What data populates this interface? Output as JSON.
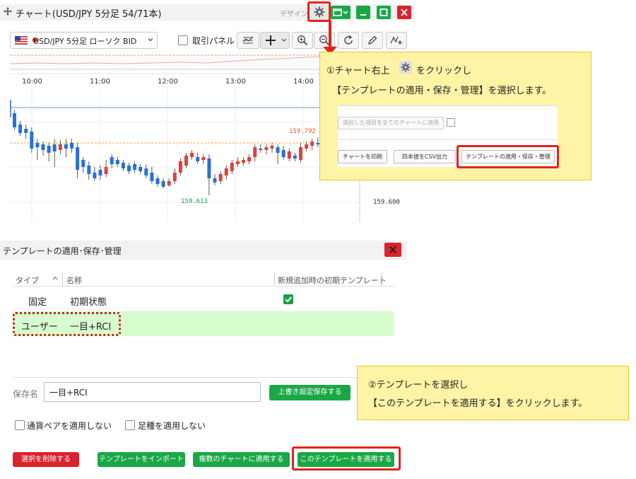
{
  "chart_window": {
    "title": "チャート(USD/JPY 5分足 54/71本)",
    "design_label": "デザイン",
    "pair_select": "USD/JPY 5分足 ローソク BID",
    "trade_panel_label": "取引パネル",
    "time_labels": [
      "10:00",
      "11:00",
      "12:00",
      "13:00",
      "14:00"
    ],
    "high_label": "159.792",
    "low_label": "159.613",
    "price_label": "159.600"
  },
  "callout1": {
    "line1_prefix": "①チャート右上",
    "line1_suffix": "をクリックし",
    "line2": "【テンプレートの適用・保存・管理】を選択します。",
    "mini": {
      "apply_all": "選択した項目を全てのチャートに適用",
      "print": "チャートを印刷",
      "csv": "四本値をCSV出力",
      "template": "テンプレートの適用・保存・管理"
    }
  },
  "dialog": {
    "title": "テンプレートの適用･保存･管理",
    "columns": {
      "type": "タイプ",
      "name": "名称",
      "default": "新規追加時の初期テンプレート"
    },
    "rows": [
      {
        "type": "固定",
        "name": "初期状態"
      },
      {
        "type": "ユーザー",
        "name": "一目+RCI"
      }
    ],
    "save_name_label": "保存名",
    "save_name_value": "一目+RCI",
    "overwrite_button": "上書き設定保存する",
    "no_pair_label": "通貨ペアを適用しない",
    "no_timeframe_label": "足種を適用しない",
    "delete_button": "選択を削除する",
    "import_button": "テンプレートをインポート",
    "multi_button": "複数のチャートに適用する",
    "apply_button": "このテンプレートを適用する"
  },
  "callout2": {
    "line1": "②テンプレートを選択し",
    "line2": "【このテンプレートを適用する】をクリックします。"
  },
  "colors": {
    "accent_green": "#1aa846",
    "close_red": "#d9232d",
    "highlight_red": "#e2231a",
    "callout_yellow": "#fff3a6",
    "selected_row": "#d7fdcf",
    "bull_candle": "#e0413a",
    "bear_candle": "#2a6fd6"
  },
  "icons": [
    "move-icon",
    "gear-icon",
    "layout-icon",
    "minimize-icon",
    "maximize-icon",
    "close-icon",
    "us-flag-icon",
    "chevron-down-icon",
    "indicator-icon",
    "crosshair-icon",
    "zoom-in-icon",
    "zoom-out-icon",
    "refresh-icon",
    "pencil-icon",
    "drawing-tool-icon",
    "checkbox-checked-icon",
    "sort-up-icon"
  ]
}
